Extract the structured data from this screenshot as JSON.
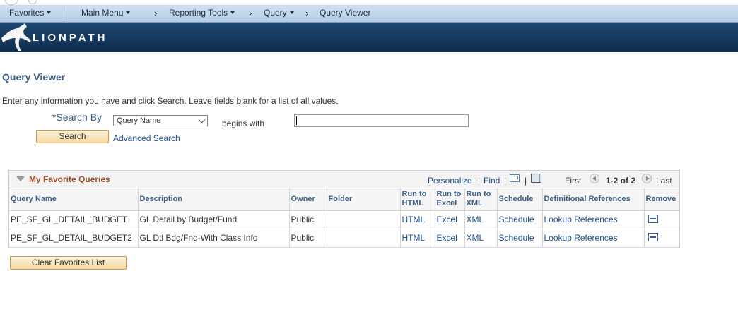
{
  "nav": {
    "favorites": "Favorites",
    "main_menu": "Main Menu",
    "reporting_tools": "Reporting Tools",
    "query": "Query",
    "query_viewer": "Query Viewer",
    "chevron": "›"
  },
  "brand": {
    "name": "LIONPATH"
  },
  "page": {
    "title": "Query Viewer",
    "instructions": "Enter any information you have and click Search. Leave fields blank for a list of all values."
  },
  "search": {
    "label": "*Search By",
    "select_value": "Query Name",
    "operator": "begins with",
    "input_value": "",
    "search_button": "Search",
    "advanced_link": "Advanced Search"
  },
  "grid": {
    "title": "My Favorite Queries",
    "personalize": "Personalize",
    "find": "Find",
    "pipe": "|",
    "first": "First",
    "count": "1-2 of 2",
    "last": "Last",
    "columns": {
      "query_name": "Query Name",
      "description": "Description",
      "owner": "Owner",
      "folder": "Folder",
      "run_html_1": "Run to",
      "run_html_2": "HTML",
      "run_excel_1": "Run to",
      "run_excel_2": "Excel",
      "run_xml_1": "Run to",
      "run_xml_2": "XML",
      "schedule": "Schedule",
      "def_refs": "Definitional References",
      "remove": "Remove"
    },
    "rows": [
      {
        "query_name": "PE_SF_GL_DETAIL_BUDGET",
        "description": "GL Detail by Budget/Fund",
        "owner": "Public",
        "folder": "",
        "html": "HTML",
        "excel": "Excel",
        "xml": "XML",
        "schedule": "Schedule",
        "refs": "Lookup References"
      },
      {
        "query_name": "PE_SF_GL_DETAIL_BUDGET2",
        "description": "GL Dtl Bdg/Fnd-With Class Info",
        "owner": "Public",
        "folder": "",
        "html": "HTML",
        "excel": "Excel",
        "xml": "XML",
        "schedule": "Schedule",
        "refs": "Lookup References"
      }
    ]
  },
  "clear_button": "Clear Favorites List",
  "colors": {
    "nav_bg": "#c4d8ec",
    "banner_bg": "#163a5f",
    "link": "#1f4f8f",
    "title": "#3f5f85",
    "grid_title": "#a0522d",
    "button_bg": "#f6d9a2"
  }
}
